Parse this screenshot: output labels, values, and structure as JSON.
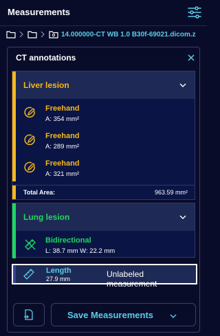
{
  "header": {
    "title": "Measurements"
  },
  "breadcrumb": {
    "current": "14.000000-CT WB 1.0 B30f-69021.dicom.z"
  },
  "panel": {
    "title": "CT annotations"
  },
  "groups": [
    {
      "name": "Liver lesion",
      "color": "#f5b71b",
      "items": [
        {
          "label": "Freehand",
          "value": "A: 354 mm²"
        },
        {
          "label": "Freehand",
          "value": "A: 289 mm²"
        },
        {
          "label": "Freehand",
          "value": "A: 321 mm²"
        }
      ],
      "total": {
        "label": "Total Area:",
        "value": "963.59 mm²"
      }
    },
    {
      "name": "Lung lesion",
      "color": "#1ed75f",
      "items": [
        {
          "label": "Bidirectional",
          "value": "L: 38.7 mm W: 22.2 mm"
        }
      ]
    }
  ],
  "unlabeled": {
    "label": "Length",
    "value": "27.9 mm",
    "name": "Unlabeled measurement"
  },
  "footer": {
    "save_label": "Save Measurements"
  },
  "icons": {
    "settings": "sliders-icon",
    "folder": "folder-icon",
    "close": "close-icon",
    "freehand": "freehand-pencil-icon",
    "bidirectional": "ruler-cross-icon",
    "length": "ruler-icon",
    "export": "document-export-icon"
  }
}
